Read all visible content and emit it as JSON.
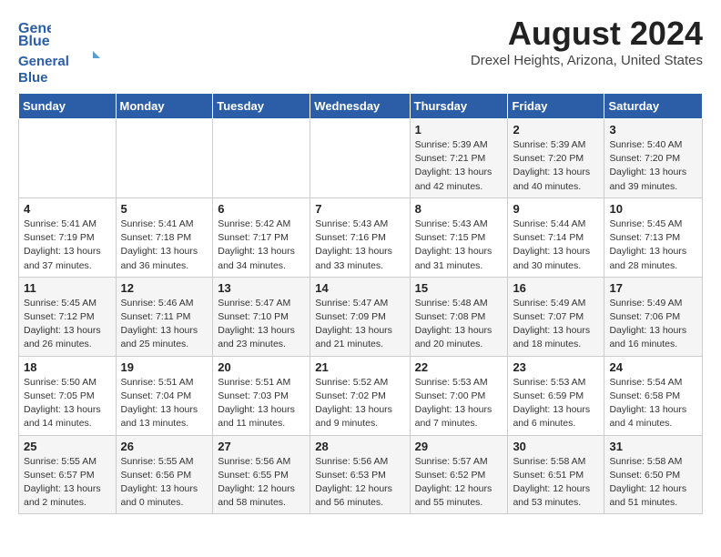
{
  "header": {
    "logo_line1": "General",
    "logo_line2": "Blue",
    "title": "August 2024",
    "subtitle": "Drexel Heights, Arizona, United States"
  },
  "days_of_week": [
    "Sunday",
    "Monday",
    "Tuesday",
    "Wednesday",
    "Thursday",
    "Friday",
    "Saturday"
  ],
  "weeks": [
    [
      {
        "day": "",
        "info": ""
      },
      {
        "day": "",
        "info": ""
      },
      {
        "day": "",
        "info": ""
      },
      {
        "day": "",
        "info": ""
      },
      {
        "day": "1",
        "info": "Sunrise: 5:39 AM\nSunset: 7:21 PM\nDaylight: 13 hours\nand 42 minutes."
      },
      {
        "day": "2",
        "info": "Sunrise: 5:39 AM\nSunset: 7:20 PM\nDaylight: 13 hours\nand 40 minutes."
      },
      {
        "day": "3",
        "info": "Sunrise: 5:40 AM\nSunset: 7:20 PM\nDaylight: 13 hours\nand 39 minutes."
      }
    ],
    [
      {
        "day": "4",
        "info": "Sunrise: 5:41 AM\nSunset: 7:19 PM\nDaylight: 13 hours\nand 37 minutes."
      },
      {
        "day": "5",
        "info": "Sunrise: 5:41 AM\nSunset: 7:18 PM\nDaylight: 13 hours\nand 36 minutes."
      },
      {
        "day": "6",
        "info": "Sunrise: 5:42 AM\nSunset: 7:17 PM\nDaylight: 13 hours\nand 34 minutes."
      },
      {
        "day": "7",
        "info": "Sunrise: 5:43 AM\nSunset: 7:16 PM\nDaylight: 13 hours\nand 33 minutes."
      },
      {
        "day": "8",
        "info": "Sunrise: 5:43 AM\nSunset: 7:15 PM\nDaylight: 13 hours\nand 31 minutes."
      },
      {
        "day": "9",
        "info": "Sunrise: 5:44 AM\nSunset: 7:14 PM\nDaylight: 13 hours\nand 30 minutes."
      },
      {
        "day": "10",
        "info": "Sunrise: 5:45 AM\nSunset: 7:13 PM\nDaylight: 13 hours\nand 28 minutes."
      }
    ],
    [
      {
        "day": "11",
        "info": "Sunrise: 5:45 AM\nSunset: 7:12 PM\nDaylight: 13 hours\nand 26 minutes."
      },
      {
        "day": "12",
        "info": "Sunrise: 5:46 AM\nSunset: 7:11 PM\nDaylight: 13 hours\nand 25 minutes."
      },
      {
        "day": "13",
        "info": "Sunrise: 5:47 AM\nSunset: 7:10 PM\nDaylight: 13 hours\nand 23 minutes."
      },
      {
        "day": "14",
        "info": "Sunrise: 5:47 AM\nSunset: 7:09 PM\nDaylight: 13 hours\nand 21 minutes."
      },
      {
        "day": "15",
        "info": "Sunrise: 5:48 AM\nSunset: 7:08 PM\nDaylight: 13 hours\nand 20 minutes."
      },
      {
        "day": "16",
        "info": "Sunrise: 5:49 AM\nSunset: 7:07 PM\nDaylight: 13 hours\nand 18 minutes."
      },
      {
        "day": "17",
        "info": "Sunrise: 5:49 AM\nSunset: 7:06 PM\nDaylight: 13 hours\nand 16 minutes."
      }
    ],
    [
      {
        "day": "18",
        "info": "Sunrise: 5:50 AM\nSunset: 7:05 PM\nDaylight: 13 hours\nand 14 minutes."
      },
      {
        "day": "19",
        "info": "Sunrise: 5:51 AM\nSunset: 7:04 PM\nDaylight: 13 hours\nand 13 minutes."
      },
      {
        "day": "20",
        "info": "Sunrise: 5:51 AM\nSunset: 7:03 PM\nDaylight: 13 hours\nand 11 minutes."
      },
      {
        "day": "21",
        "info": "Sunrise: 5:52 AM\nSunset: 7:02 PM\nDaylight: 13 hours\nand 9 minutes."
      },
      {
        "day": "22",
        "info": "Sunrise: 5:53 AM\nSunset: 7:00 PM\nDaylight: 13 hours\nand 7 minutes."
      },
      {
        "day": "23",
        "info": "Sunrise: 5:53 AM\nSunset: 6:59 PM\nDaylight: 13 hours\nand 6 minutes."
      },
      {
        "day": "24",
        "info": "Sunrise: 5:54 AM\nSunset: 6:58 PM\nDaylight: 13 hours\nand 4 minutes."
      }
    ],
    [
      {
        "day": "25",
        "info": "Sunrise: 5:55 AM\nSunset: 6:57 PM\nDaylight: 13 hours\nand 2 minutes."
      },
      {
        "day": "26",
        "info": "Sunrise: 5:55 AM\nSunset: 6:56 PM\nDaylight: 13 hours\nand 0 minutes."
      },
      {
        "day": "27",
        "info": "Sunrise: 5:56 AM\nSunset: 6:55 PM\nDaylight: 12 hours\nand 58 minutes."
      },
      {
        "day": "28",
        "info": "Sunrise: 5:56 AM\nSunset: 6:53 PM\nDaylight: 12 hours\nand 56 minutes."
      },
      {
        "day": "29",
        "info": "Sunrise: 5:57 AM\nSunset: 6:52 PM\nDaylight: 12 hours\nand 55 minutes."
      },
      {
        "day": "30",
        "info": "Sunrise: 5:58 AM\nSunset: 6:51 PM\nDaylight: 12 hours\nand 53 minutes."
      },
      {
        "day": "31",
        "info": "Sunrise: 5:58 AM\nSunset: 6:50 PM\nDaylight: 12 hours\nand 51 minutes."
      }
    ]
  ]
}
